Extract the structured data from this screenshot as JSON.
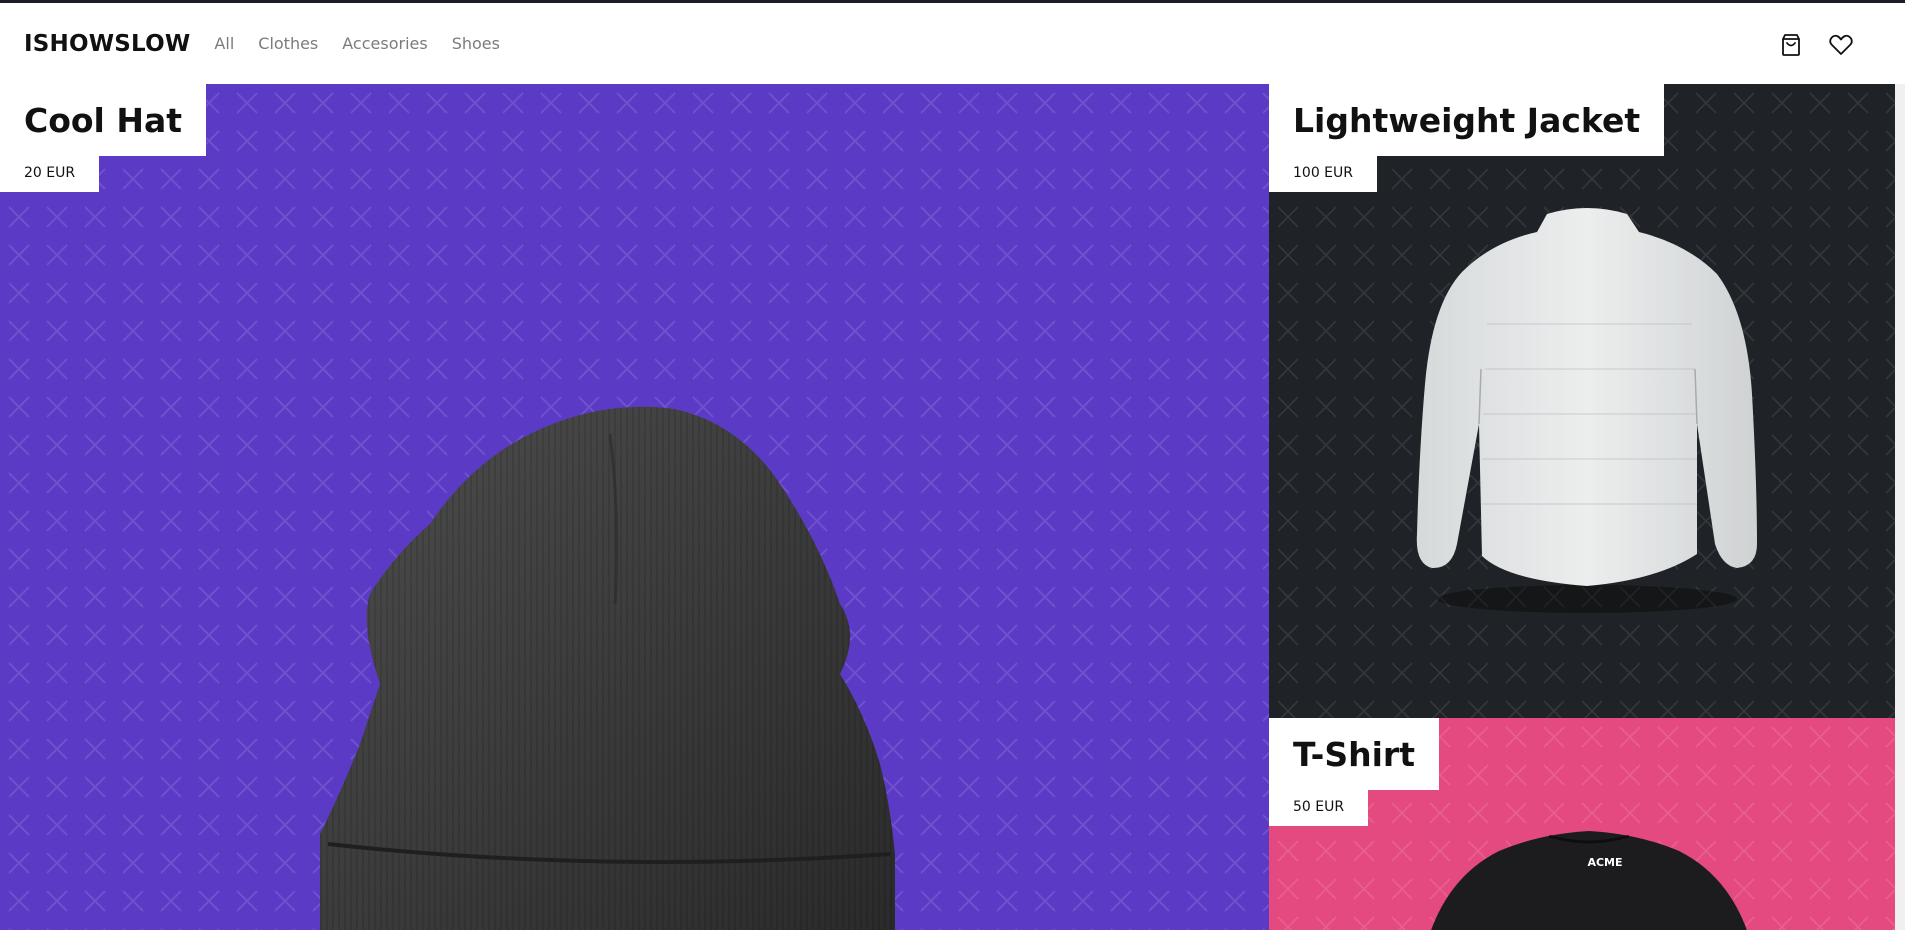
{
  "nav": {
    "brand": "ISHOWSLOW",
    "links": [
      "All",
      "Clothes",
      "Accesories",
      "Shoes"
    ],
    "icons": [
      "shopping-bag-icon",
      "heart-icon"
    ]
  },
  "products": [
    {
      "title": "Cool Hat",
      "price": "20 EUR",
      "background": "#5b3bc6"
    },
    {
      "title": "Lightweight Jacket",
      "price": "100 EUR",
      "background": "#1f2226"
    },
    {
      "title": "T-Shirt",
      "price": "50 EUR",
      "background": "#e44a80",
      "print": "ACME"
    }
  ]
}
